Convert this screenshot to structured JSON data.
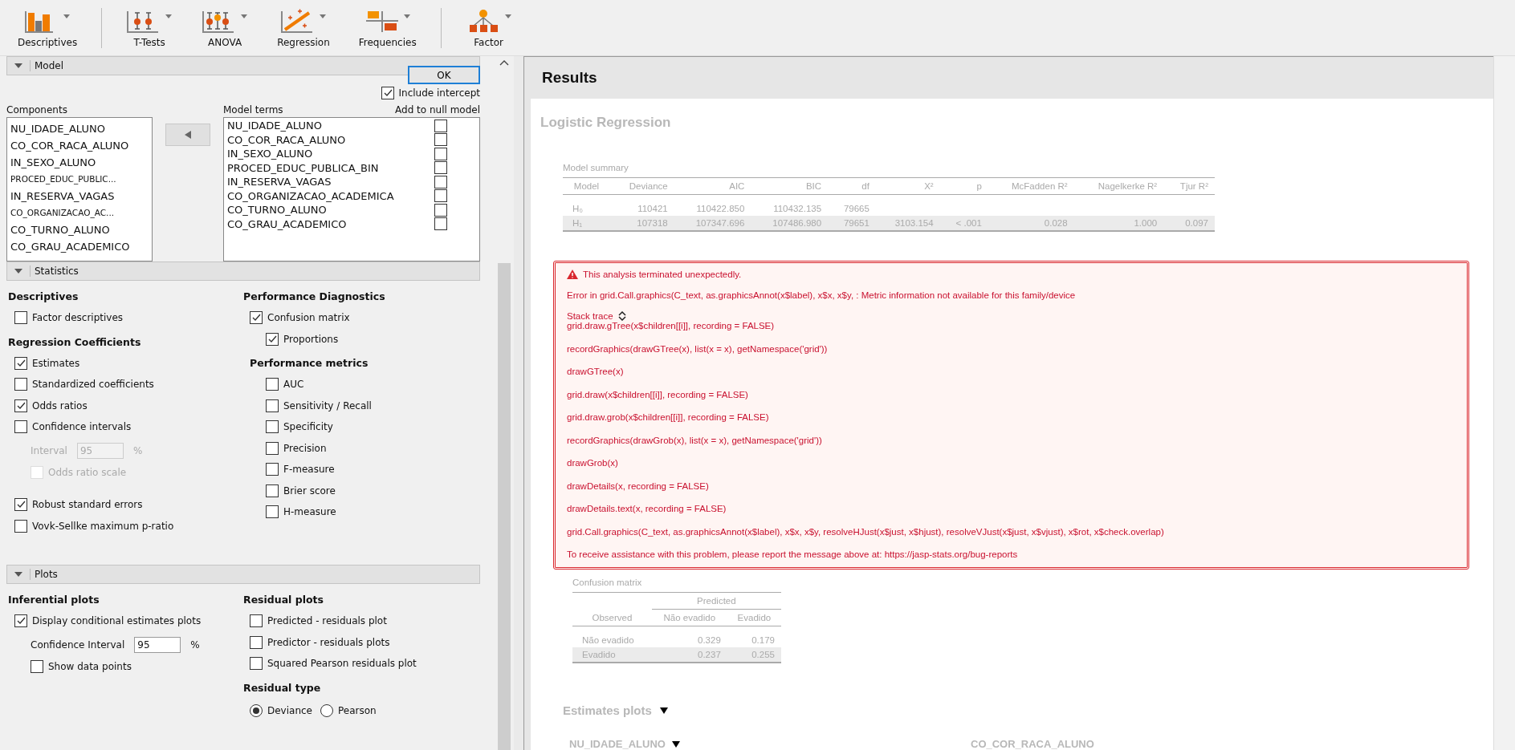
{
  "toolbar": {
    "groups": [
      [
        {
          "label": "Descriptives",
          "kind": "descriptives"
        }
      ],
      [
        {
          "label": "T-Tests",
          "kind": "ttest"
        },
        {
          "label": "ANOVA",
          "kind": "anova"
        },
        {
          "label": "Regression",
          "kind": "regression"
        },
        {
          "label": "Frequencies",
          "kind": "frequencies"
        }
      ],
      [
        {
          "label": "Factor",
          "kind": "factor"
        }
      ]
    ]
  },
  "model": {
    "title": "Model",
    "expanded": true,
    "ok_button": "OK",
    "include_intercept": {
      "label": "Include intercept",
      "checked": true
    },
    "components": {
      "title": "Components",
      "items": [
        "NU_IDADE_ALUNO",
        "CO_COR_RACA_ALUNO",
        "IN_SEXO_ALUNO",
        "PROCED_EDUC_PUBLIC...",
        "IN_RESERVA_VAGAS",
        "CO_ORGANIZACAO_AC...",
        "CO_TURNO_ALUNO",
        "CO_GRAU_ACADEMICO"
      ]
    },
    "model_terms": {
      "title": "Model terms",
      "null_header": "Add to null model",
      "items": [
        {
          "name": "NU_IDADE_ALUNO",
          "add_to_null": false
        },
        {
          "name": "CO_COR_RACA_ALUNO",
          "add_to_null": false
        },
        {
          "name": "IN_SEXO_ALUNO",
          "add_to_null": false
        },
        {
          "name": "PROCED_EDUC_PUBLICA_BIN",
          "add_to_null": false
        },
        {
          "name": "IN_RESERVA_VAGAS",
          "add_to_null": false
        },
        {
          "name": "CO_ORGANIZACAO_ACADEMICA",
          "add_to_null": false
        },
        {
          "name": "CO_TURNO_ALUNO",
          "add_to_null": false
        },
        {
          "name": "CO_GRAU_ACADEMICO",
          "add_to_null": false
        }
      ]
    }
  },
  "sections": [
    {
      "title": "Statistics",
      "expanded": true,
      "columns": [
        {
          "items": [
            {
              "kind": "heading",
              "text": "Descriptives",
              "children": [
                {
                  "kind": "check",
                  "label": "Factor descriptives",
                  "checked": false,
                  "disabled": false
                }
              ]
            },
            {
              "kind": "heading",
              "text": "Regression Coefficients",
              "children": [
                {
                  "kind": "check",
                  "label": "Estimates",
                  "checked": true,
                  "disabled": false
                },
                {
                  "kind": "check",
                  "label": "Standardized coefficients",
                  "checked": false,
                  "disabled": false
                },
                {
                  "kind": "check",
                  "label": "Odds ratios",
                  "checked": true,
                  "disabled": false
                },
                {
                  "kind": "check",
                  "label": "Confidence intervals",
                  "checked": false,
                  "disabled": false,
                  "children": [
                    {
                      "kind": "field",
                      "label": "Interval",
                      "value": "95",
                      "unit": "%",
                      "disabled": true
                    },
                    {
                      "kind": "check",
                      "label": "Odds ratio scale",
                      "checked": false,
                      "disabled": true
                    }
                  ]
                },
                {
                  "kind": "spacer"
                },
                {
                  "kind": "check",
                  "label": "Robust standard errors",
                  "checked": true,
                  "disabled": false
                },
                {
                  "kind": "check",
                  "label": "Vovk-Sellke maximum p-ratio",
                  "checked": false,
                  "disabled": false
                }
              ]
            }
          ]
        },
        {
          "items": [
            {
              "kind": "heading",
              "text": "Performance Diagnostics",
              "children": [
                {
                  "kind": "check",
                  "label": "Confusion matrix",
                  "checked": true,
                  "disabled": false,
                  "children": [
                    {
                      "kind": "check",
                      "label": "Proportions",
                      "checked": true,
                      "disabled": false
                    }
                  ]
                },
                {
                  "kind": "heading",
                  "text": "Performance metrics",
                  "children": [
                    {
                      "kind": "check",
                      "label": "AUC",
                      "checked": false,
                      "disabled": false
                    },
                    {
                      "kind": "check",
                      "label": "Sensitivity / Recall",
                      "checked": false,
                      "disabled": false
                    },
                    {
                      "kind": "check",
                      "label": "Specificity",
                      "checked": false,
                      "disabled": false
                    },
                    {
                      "kind": "check",
                      "label": "Precision",
                      "checked": false,
                      "disabled": false
                    },
                    {
                      "kind": "check",
                      "label": "F-measure",
                      "checked": false,
                      "disabled": false
                    },
                    {
                      "kind": "check",
                      "label": "Brier score",
                      "checked": false,
                      "disabled": false
                    },
                    {
                      "kind": "check",
                      "label": "H-measure",
                      "checked": false,
                      "disabled": false
                    }
                  ]
                }
              ]
            }
          ]
        }
      ]
    },
    {
      "title": "Plots",
      "expanded": true,
      "columns": [
        {
          "items": [
            {
              "kind": "heading",
              "text": "Inferential plots",
              "children": [
                {
                  "kind": "check",
                  "label": "Display conditional estimates plots",
                  "checked": true,
                  "disabled": false,
                  "children": [
                    {
                      "kind": "field",
                      "label": "Confidence Interval",
                      "value": "95",
                      "unit": "%",
                      "disabled": false
                    },
                    {
                      "kind": "check",
                      "label": "Show data points",
                      "checked": false,
                      "disabled": false
                    }
                  ]
                }
              ]
            }
          ]
        },
        {
          "items": [
            {
              "kind": "heading",
              "text": "Residual plots",
              "children": [
                {
                  "kind": "check",
                  "label": "Predicted - residuals plot",
                  "checked": false,
                  "disabled": false
                },
                {
                  "kind": "check",
                  "label": "Predictor - residuals plots",
                  "checked": false,
                  "disabled": false
                },
                {
                  "kind": "check",
                  "label": "Squared Pearson residuals plot",
                  "checked": false,
                  "disabled": false
                }
              ]
            },
            {
              "kind": "heading",
              "text": "Residual type",
              "children": [
                {
                  "kind": "radios",
                  "options": [
                    {
                      "label": "Deviance",
                      "selected": true
                    },
                    {
                      "label": "Pearson",
                      "selected": false
                    }
                  ]
                }
              ]
            }
          ]
        }
      ]
    }
  ],
  "results": {
    "title": "Results",
    "analysis_title": "Logistic Regression",
    "model_summary": {
      "title": "Model summary",
      "columns": [
        "Model",
        "Deviance",
        "AIC",
        "BIC",
        "df",
        "X²",
        "p",
        "McFadden R²",
        "Nagelkerke R²",
        "Tjur R²"
      ],
      "rows": [
        [
          "H₀",
          "110421",
          "110422.850",
          "110432.135",
          "79665",
          "",
          "",
          "",
          "",
          ""
        ],
        [
          "H₁",
          "107318",
          "107347.696",
          "107486.980",
          "79651",
          "3103.154",
          "< .001",
          "0.028",
          "1.000",
          "0.097"
        ]
      ]
    },
    "error": {
      "title": "This analysis terminated unexpectedly.",
      "message": "Error in grid.Call.graphics(C_text, as.graphicsAnnot(x$label), x$x, x$y, : Metric information not available for this family/device",
      "stack_label": "Stack trace",
      "stack": [
        "grid.draw.gTree(x$children[[i]], recording = FALSE)",
        "recordGraphics(drawGTree(x), list(x = x), getNamespace('grid'))",
        "drawGTree(x)",
        "grid.draw(x$children[[i]], recording = FALSE)",
        "grid.draw.grob(x$children[[i]], recording = FALSE)",
        "recordGraphics(drawGrob(x), list(x = x), getNamespace('grid'))",
        "drawGrob(x)",
        "drawDetails(x, recording = FALSE)",
        "drawDetails.text(x, recording = FALSE)",
        "grid.Call.graphics(C_text, as.graphicsAnnot(x$label), x$x, x$y, resolveHJust(x$just, x$hjust), resolveVJust(x$just, x$vjust), x$rot, x$check.overlap)"
      ],
      "footer": "To receive assistance with this problem, please report the message above at: https://jasp-stats.org/bug-reports"
    },
    "confusion_matrix": {
      "title": "Confusion matrix",
      "spanner": "Predicted",
      "columns": [
        "Observed",
        "Não evadido",
        "Evadido"
      ],
      "rows": [
        [
          "Não evadido",
          "0.329",
          "0.179"
        ],
        [
          "Evadido",
          "0.237",
          "0.255"
        ]
      ]
    },
    "estimates_plots": {
      "title": "Estimates plots",
      "plots": [
        {
          "title": "NU_IDADE_ALUNO",
          "dropdown": true
        },
        {
          "title": "CO_COR_RACA_ALUNO",
          "dropdown": false
        }
      ]
    }
  }
}
